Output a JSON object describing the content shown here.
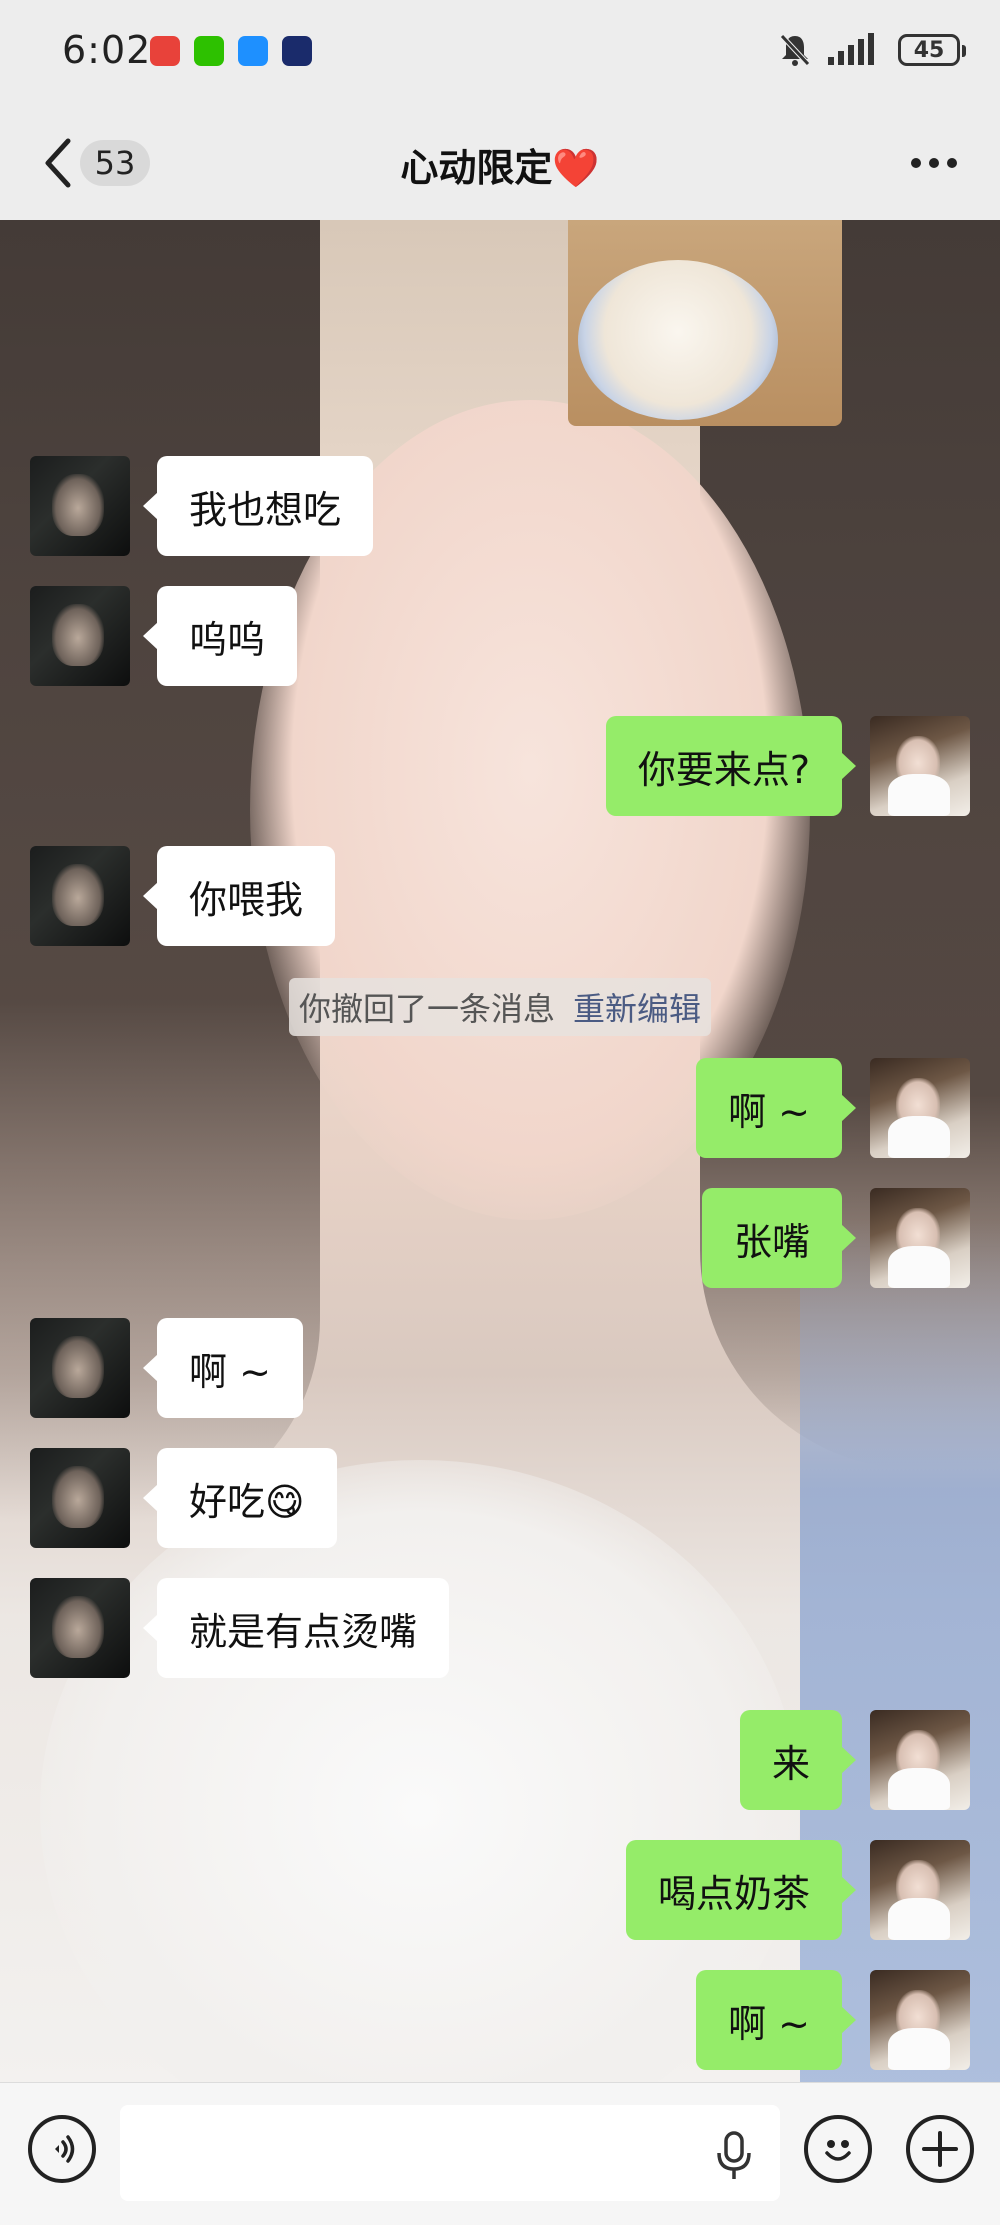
{
  "status_bar": {
    "time": "6:02",
    "battery": "45",
    "app_icons": [
      "pinduoduo-icon",
      "wechat-icon",
      "message-icon",
      "qq-icon"
    ]
  },
  "header": {
    "unread_count": "53",
    "title": "心动限定",
    "title_emoji": "❤️"
  },
  "messages": [
    {
      "side": "left",
      "text": "我也想吃"
    },
    {
      "side": "left",
      "text": "呜呜"
    },
    {
      "side": "right",
      "text": "你要来点?"
    },
    {
      "side": "left",
      "text": "你喂我"
    },
    {
      "side": "right",
      "text": "啊 ~"
    },
    {
      "side": "right",
      "text": "张嘴"
    },
    {
      "side": "left",
      "text": "啊 ~"
    },
    {
      "side": "left",
      "text": "好吃😋"
    },
    {
      "side": "left",
      "text": "就是有点烫嘴"
    },
    {
      "side": "right",
      "text": "来"
    },
    {
      "side": "right",
      "text": "喝点奶茶"
    },
    {
      "side": "right",
      "text": "啊 ~"
    }
  ],
  "system_notice": {
    "text": "你撤回了一条消息",
    "action": "重新编辑"
  },
  "input": {
    "placeholder": ""
  },
  "colors": {
    "outgoing_bubble": "#95ec69",
    "incoming_bubble": "#ffffff",
    "link": "#4b5b83"
  }
}
